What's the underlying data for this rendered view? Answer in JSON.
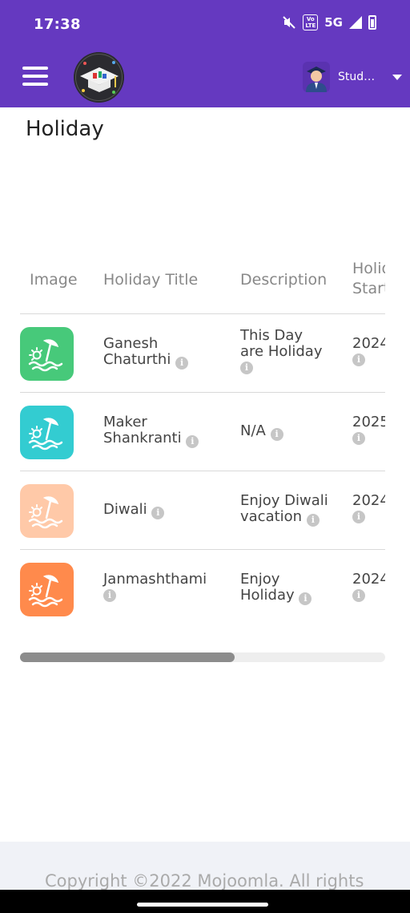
{
  "status_bar": {
    "time": "17:38",
    "network": "5G",
    "volte": "Vo LTE"
  },
  "header": {
    "user_name": "Student",
    "colors": {
      "bar": "#6539c0"
    }
  },
  "page": {
    "title": "Holiday"
  },
  "table": {
    "columns": [
      "Image",
      "Holiday Title",
      "Description",
      "Holiday Start"
    ],
    "rows": [
      {
        "title_line1": "Ganesh",
        "title_line2": "Chaturthi",
        "desc_line1": "This Day",
        "desc_line2": "are Holiday",
        "start": "2024",
        "image_color": "#47c97a",
        "icon": "beach-umbrella-icon"
      },
      {
        "title_line1": "Maker",
        "title_line2": "Shankranti",
        "desc_line1": "N/A",
        "desc_line2": "",
        "start": "2025",
        "image_color": "#33ccd1",
        "icon": "beach-umbrella-icon"
      },
      {
        "title_line1": "Diwali",
        "title_line2": "",
        "desc_line1": "Enjoy Diwali",
        "desc_line2": "vacation",
        "start": "2024",
        "image_color": "#ffc9a8",
        "icon": "beach-umbrella-icon"
      },
      {
        "title_line1": "Janmashthami",
        "title_line2": "",
        "desc_line1": "Enjoy",
        "desc_line2": "Holiday",
        "start": "2024",
        "image_color": "#ff8a4c",
        "icon": "beach-umbrella-icon"
      }
    ]
  },
  "footer": {
    "copyright": "Copyright ©2022 Mojoomla. All rights"
  }
}
